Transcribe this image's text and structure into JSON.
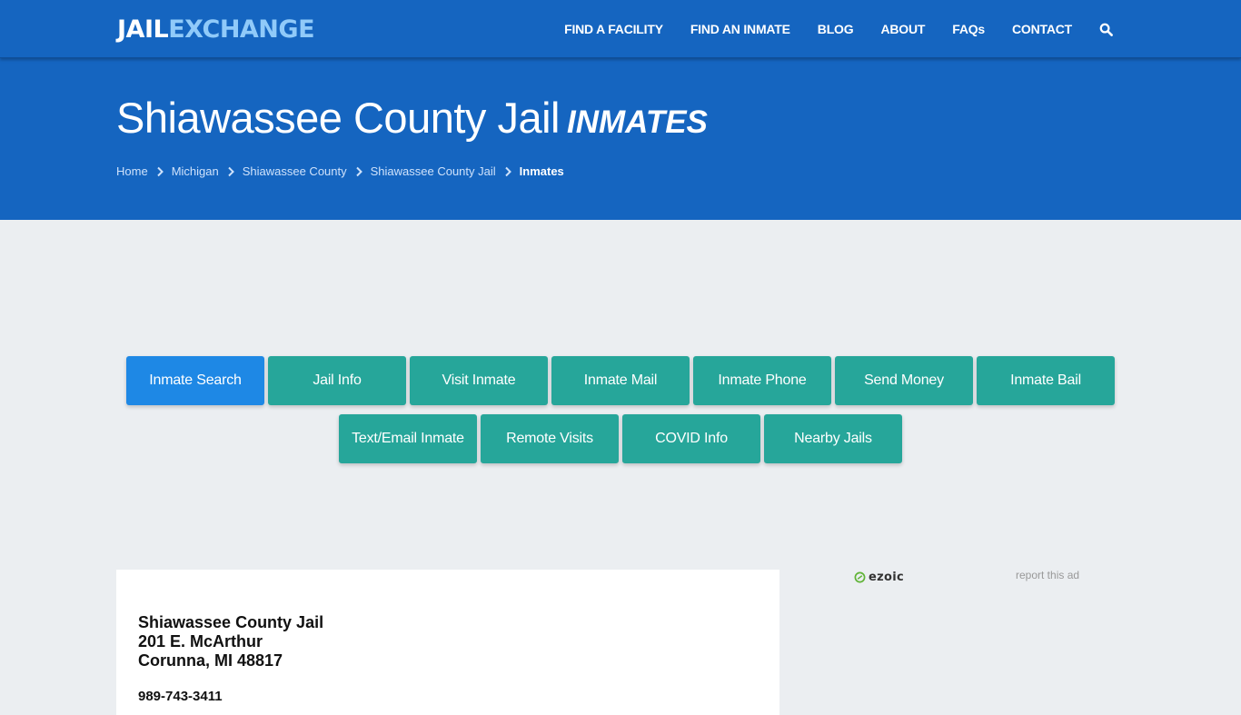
{
  "brand": {
    "part1": "JAIL",
    "part2": "EXCHANGE",
    "color_primary": "#1565c0",
    "color_accent": "#90caf9"
  },
  "nav": {
    "links": [
      "FIND A FACILITY",
      "FIND AN INMATE",
      "BLOG",
      "ABOUT",
      "FAQs",
      "CONTACT"
    ],
    "search_icon": "search-icon"
  },
  "hero": {
    "title": "Shiawassee County Jail",
    "subtitle": "INMATES"
  },
  "breadcrumb": {
    "items": [
      "Home",
      "Michigan",
      "Shiawassee County",
      "Shiawassee County Jail"
    ],
    "current": "Inmates"
  },
  "buttons": {
    "active_color": "#1e88e5",
    "default_color": "#26a69a",
    "items": [
      {
        "label": "Inmate Search",
        "active": true
      },
      {
        "label": "Jail Info",
        "active": false
      },
      {
        "label": "Visit Inmate",
        "active": false
      },
      {
        "label": "Inmate Mail",
        "active": false
      },
      {
        "label": "Inmate Phone",
        "active": false
      },
      {
        "label": "Send Money",
        "active": false
      },
      {
        "label": "Inmate Bail",
        "active": false
      },
      {
        "label": "Text/Email Inmate",
        "active": false
      },
      {
        "label": "Remote Visits",
        "active": false
      },
      {
        "label": "COVID Info",
        "active": false
      },
      {
        "label": "Nearby Jails",
        "active": false
      }
    ]
  },
  "facility": {
    "name": "Shiawassee County Jail",
    "address_line1": "201 E. McArthur",
    "address_line2": "Corunna, MI 48817",
    "phone": "989-743-3411"
  },
  "ad": {
    "provider": "ezoic",
    "report_label": "report this ad"
  }
}
